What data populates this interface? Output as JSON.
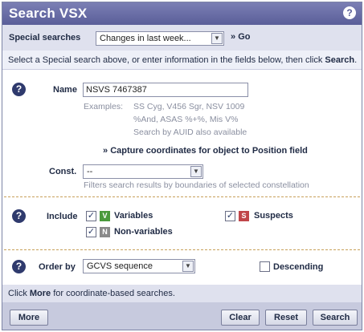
{
  "title": "Search VSX",
  "title_help_icon": "question-icon",
  "special": {
    "label": "Special searches",
    "selected": "Changes in last week...",
    "go_arrow": "»",
    "go_label": "Go"
  },
  "info_text_prefix": "Select a Special search above, or enter information in the fields below, then click ",
  "info_text_bold": "Search",
  "info_text_suffix": ".",
  "name": {
    "label": "Name",
    "value": "NSVS 7467387",
    "examples_label": "Examples:",
    "examples_line1": "SS Cyg, V456 Sgr, NSV 1009",
    "examples_line2": "%And, ASAS %+%, Mis V%",
    "auid_note": "Search by AUID also available"
  },
  "capture": {
    "arrow": "»",
    "label": "Capture coordinates for object to Position field"
  },
  "const": {
    "label": "Const.",
    "selected": "--",
    "note": "Filters search results by boundaries of selected constellation"
  },
  "include": {
    "label": "Include",
    "variables": {
      "badge": "V",
      "label": "Variables",
      "checked": true,
      "color": "#4a9a3c"
    },
    "suspects": {
      "badge": "S",
      "label": "Suspects",
      "checked": true,
      "color": "#c0464a"
    },
    "nonvariables": {
      "badge": "N",
      "label": "Non-variables",
      "checked": true,
      "color": "#8a8a8a"
    }
  },
  "order": {
    "label": "Order by",
    "selected": "GCVS sequence",
    "descending_label": "Descending",
    "descending_checked": false
  },
  "more_text_prefix": "Click ",
  "more_text_bold": "More",
  "more_text_suffix": " for coordinate-based searches.",
  "buttons": {
    "more": "More",
    "clear": "Clear",
    "reset": "Reset",
    "search": "Search"
  }
}
